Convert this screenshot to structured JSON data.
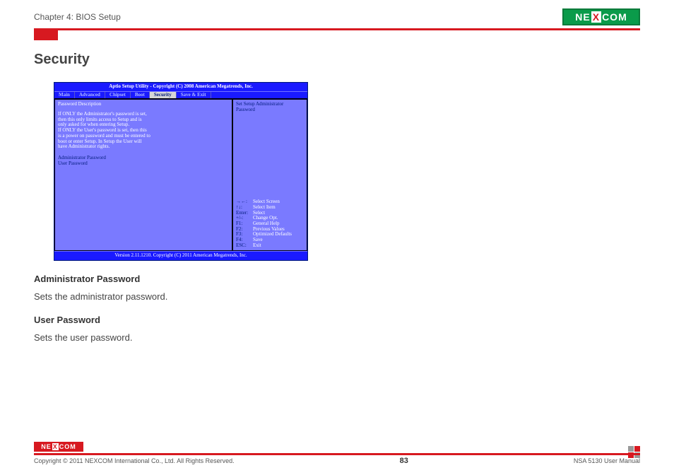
{
  "header": {
    "chapter": "Chapter 4: BIOS Setup",
    "logo_left": "NE",
    "logo_x": "X",
    "logo_right": "COM"
  },
  "section_title": "Security",
  "bios": {
    "title": "Aptio Setup Utility - Copyright (C) 2008 American Megatrends, Inc.",
    "tabs": [
      "Main",
      "Advanced",
      "Chipset",
      "Boot",
      "Security",
      "Save & Exit"
    ],
    "active_tab_index": 4,
    "left": {
      "heading": "Password Description",
      "para1_l1": "If ONLY the Administrator's password is set,",
      "para1_l2": "then this only limits access to Setup and is",
      "para1_l3": "only asked for when entering Setup.",
      "para2_l1": "If ONLY the User's password is set, then this",
      "para2_l2": "is a power on password and must be entered to",
      "para2_l3": "boot or enter Setup. In Setup the User will",
      "para2_l4": "have Administrator rights.",
      "item1": "Administrator Password",
      "item2": "User Password"
    },
    "right": {
      "hint_top_l1": "Set Setup Administrator",
      "hint_top_l2": "Password",
      "keys": [
        {
          "k": "→←:",
          "v": "Select Screen"
        },
        {
          "k": "↑↓:",
          "v": "Select Item"
        },
        {
          "k": "Enter:",
          "v": "Select"
        },
        {
          "k": "+/-:",
          "v": "Change Opt."
        },
        {
          "k": "F1:",
          "v": "General Help"
        },
        {
          "k": "F2:",
          "v": "Previous Values"
        },
        {
          "k": "F3:",
          "v": "Optimized Defaults"
        },
        {
          "k": "F4:",
          "v": "Save"
        },
        {
          "k": "ESC:",
          "v": "Exit"
        }
      ]
    },
    "footer": "Version 2.11.1210. Copyright (C) 2011 American Megatrends, Inc."
  },
  "sub1_title": "Administrator Password",
  "sub1_desc": "Sets the administrator password.",
  "sub2_title": "User Password",
  "sub2_desc": "Sets the user password.",
  "footer": {
    "copyright": "Copyright © 2011 NEXCOM International Co., Ltd. All Rights Reserved.",
    "page": "83",
    "manual": "NSA 5130 User Manual"
  }
}
